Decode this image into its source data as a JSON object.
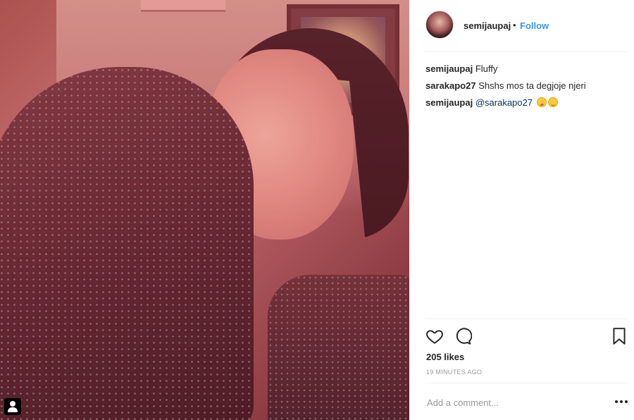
{
  "post": {
    "username": "semijaupaj",
    "separator": "•",
    "follow_label": "Follow"
  },
  "comments": [
    {
      "user": "semijaupaj",
      "text": "Fluffy"
    },
    {
      "user": "sarakapo27",
      "text": "Shshs mos ta degjoje njeri"
    },
    {
      "user": "semijaupaj",
      "mention": "@sarakapo27",
      "emojis": [
        "tongue-face-emoji",
        "smiling-face-emoji"
      ]
    }
  ],
  "actions": {
    "icons": [
      "heart-icon",
      "comment-icon",
      "bookmark-icon"
    ],
    "likes": "205 likes",
    "timestamp": "19 MINUTES AGO"
  },
  "add_comment": {
    "placeholder": "Add a comment...",
    "more_icon": "more-options-icon"
  },
  "photo": {
    "tag_icon": "tagged-user-icon"
  },
  "colors": {
    "follow_blue": "#3897f0",
    "mention_blue": "#003569",
    "muted_text": "#999999",
    "primary_text": "#262626"
  }
}
